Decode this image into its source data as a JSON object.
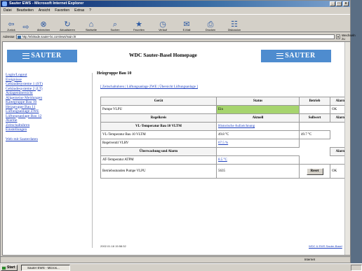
{
  "window": {
    "title": "Sauter EWS - Microsoft Internet Explorer",
    "controls": [
      "_",
      "□",
      "x"
    ]
  },
  "menu": [
    "Datei",
    "Bearbeiten",
    "Ansicht",
    "Favoriten",
    "Extras",
    "?"
  ],
  "toolbar": [
    {
      "label": "Zurück",
      "icon": "back-arrow-icon",
      "glyph": "⇦"
    },
    {
      "label": "",
      "icon": "forward-arrow-icon",
      "glyph": "⇨"
    },
    {
      "label": "Abbrechen",
      "icon": "stop-icon",
      "glyph": "⊗"
    },
    {
      "label": "Aktualisieren",
      "icon": "refresh-icon",
      "glyph": "↻"
    },
    {
      "label": "Startseite",
      "icon": "home-icon",
      "glyph": "⌂"
    },
    {
      "label": "Suchen",
      "icon": "search-icon",
      "glyph": "⌕"
    },
    {
      "label": "Favoriten",
      "icon": "favorites-icon",
      "glyph": "★"
    },
    {
      "label": "Verlauf",
      "icon": "history-icon",
      "glyph": "◷"
    },
    {
      "label": "E-Mail",
      "icon": "mail-icon",
      "glyph": "✉"
    },
    {
      "label": "Drucken",
      "icon": "print-icon",
      "glyph": "⎙"
    },
    {
      "label": "Diskussion",
      "icon": "discuss-icon",
      "glyph": "☷"
    }
  ],
  "address": {
    "label": "Adresse",
    "url": "http://ebitrade.sauter-bc.com/ews/main.ht",
    "go": "Wechseln zu"
  },
  "banner": {
    "logo_text": "SAUTER",
    "title": "WDC Sauter-Basel Homepage"
  },
  "sidebar": {
    "items": [
      "Login/Logout",
      "Ereignisse",
      "Gebäudesysteme 1 (ST)",
      "Gebäudesysteme 2 (LT)",
      "Anlagenübersicht",
      "Allgemeine Meldungen",
      "Kältegruppe Bau 10",
      "Heizgruppe Bau 11",
      "Lüftungsanlage ZWE",
      "Lüftungsanlage Bau 12",
      "Alarme",
      "Zeitschaltuhren",
      "Einstellungen"
    ],
    "extra": "Web mit Sauterdaten"
  },
  "main": {
    "title": "Heizgruppe Bau 10",
    "breadcrumb": "[ Zeitschaltuhren | Lüftungsanlage ZWE | Übersicht Lüftungsanlage ]",
    "headers": {
      "geraet": "Gerät",
      "status": "Status",
      "betrieb": "Betrieb",
      "alarm": "Alarm"
    },
    "pump_label": "Pumpe VLPU",
    "pump_status": "Ein",
    "alarm_ok": "OK",
    "regler_header": "Regelkreis",
    "aktuell": "Aktuell",
    "sollwert": "Sollwert",
    "temp_header": "VL-Temperatur Bau 10 VLTM",
    "temp_link": "Historische Aufzeichnung",
    "temp_row_label": "VL-Temperatur Bau 10 VLTM",
    "temp_actual": "49.8 °C",
    "temp_setpoint": "49.7 °C",
    "ventil_label": "Regelventil VLRV",
    "ventil_value": "67.5 %",
    "monitor_header": "Überwachung und Alarm",
    "outdoor_label": "AT-Temperatur ATPM",
    "outdoor_value": "8.5 °C",
    "hours_label": "Betriebsstunden Pumpe VLPU",
    "hours_value": "5635",
    "reset_button": "Reset",
    "footer_left": "2002.01.18 15:58:32",
    "footer_right": "WDC & EWS Sauter-Basel"
  },
  "status": {
    "zone": "Internet"
  },
  "taskbar": {
    "start": "Start",
    "task": "Sauter EWS - Micros..."
  }
}
